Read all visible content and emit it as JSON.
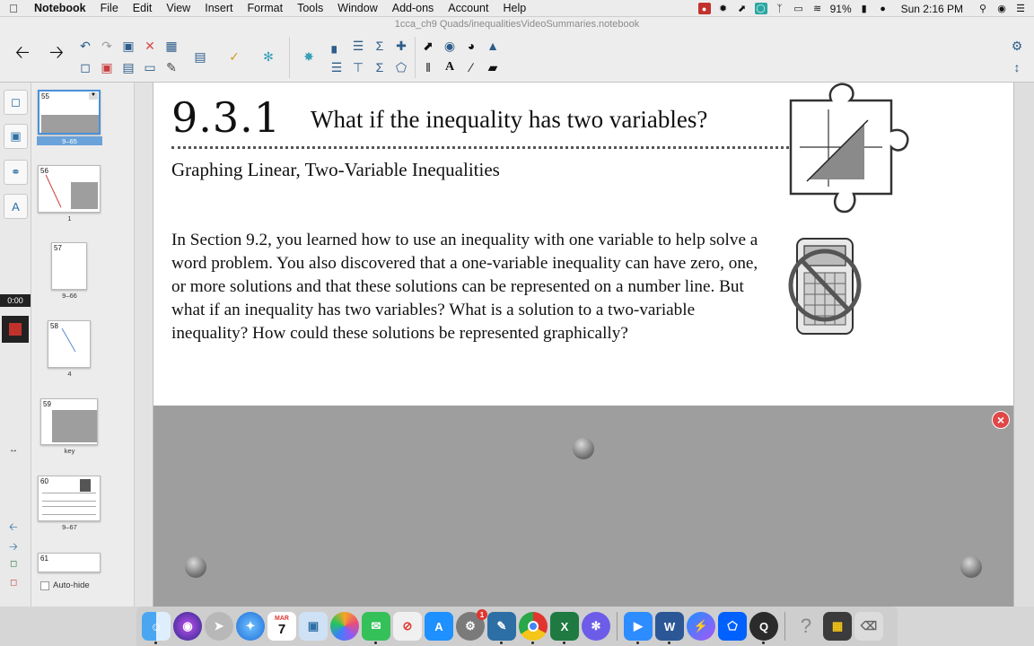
{
  "menubar": {
    "app_name": "Notebook",
    "menus": [
      "File",
      "Edit",
      "View",
      "Insert",
      "Format",
      "Tools",
      "Window",
      "Add-ons",
      "Account",
      "Help"
    ],
    "battery": "91%",
    "clock": "Sun 2:16 PM"
  },
  "window": {
    "document_title": "1cca_ch9 Quads/inequalitiesVideoSummaries.notebook"
  },
  "sidebar": {
    "timer": "0:00",
    "autohide_label": "Auto-hide",
    "autohide_checked": false
  },
  "slides": [
    {
      "num": "55",
      "label": "9–65",
      "selected": true
    },
    {
      "num": "56",
      "label": "1",
      "selected": false
    },
    {
      "num": "57",
      "label": "9–66",
      "selected": false
    },
    {
      "num": "58",
      "label": "4",
      "selected": false
    },
    {
      "num": "59",
      "label": "key",
      "selected": false
    },
    {
      "num": "60",
      "label": "9–67",
      "selected": false
    },
    {
      "num": "61",
      "label": "",
      "selected": false
    }
  ],
  "page": {
    "section_number": "9.3.1",
    "question": "What if the inequality has two variables?",
    "subheading": "Graphing Linear, Two-Variable Inequalities",
    "paragraph": "In Section 9.2, you learned how to use an inequality with one variable to help solve a word problem.  You also discovered that a one-variable inequality can have zero, one, or more solutions and that these solutions can be represented on a number line.  But what if an inequality has two variables?  What is a solution to a two-variable inequality?  How could these solutions be represented graphically?",
    "screen_shade_close_icon": "×"
  },
  "dock": {
    "calendar_month": "MAR",
    "calendar_day": "7",
    "system_prefs_badge": "1",
    "apps": [
      "finder-icon",
      "siri-icon",
      "launchpad-icon",
      "safari-icon",
      "calendar-icon",
      "preview-icon",
      "photos-icon",
      "messages-icon",
      "news-icon",
      "app-store-icon",
      "system-preferences-icon",
      "notebook-icon",
      "chrome-icon",
      "excel-icon",
      "daisy-icon",
      "zoom-icon",
      "word-icon",
      "messenger-icon",
      "dropbox-icon",
      "quicktime-icon",
      "help-icon",
      "archive-icon",
      "trash-icon"
    ]
  },
  "colors": {
    "accent_blue": "#2d6ea5",
    "close_red": "#e04848",
    "shade_gray": "#9e9e9e"
  }
}
